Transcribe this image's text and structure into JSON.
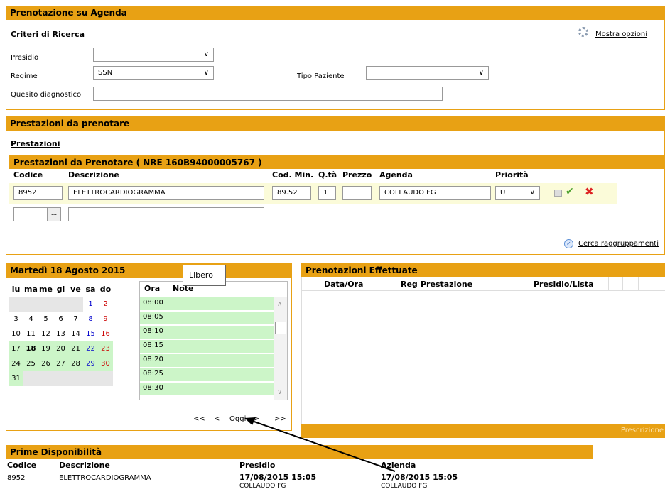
{
  "booking": {
    "title": "Prenotazione su Agenda",
    "criteria_title": "Criteri di Ricerca",
    "show_options": "Mostra opzioni",
    "presidio_label": "Presidio",
    "presidio_value": "",
    "regime_label": "Regime",
    "regime_value": "SSN",
    "tipo_paziente_label": "Tipo Paziente",
    "tipo_paziente_value": "",
    "quesito_label": "Quesito diagnostico",
    "quesito_value": ""
  },
  "prestazioni": {
    "title": "Prestazioni da prenotare",
    "link": "Prestazioni",
    "subtitle": "Prestazioni da Prenotare ( NRE 160B94000005767 )",
    "headers": [
      "Codice",
      "Descrizione",
      "Cod. Min.",
      "Q.tà",
      "Prezzo",
      "Agenda",
      "Priorità"
    ],
    "row": {
      "codice": "8952",
      "descrizione": "ELETTROCARDIOGRAMMA",
      "cod_min": "89.52",
      "qta": "1",
      "prezzo": "",
      "agenda": "COLLAUDO FG",
      "priorita": "U"
    },
    "ellipsis": "...",
    "cerca": "Cerca raggruppamenti"
  },
  "calendar": {
    "title": "Martedì 18 Agosto 2015",
    "days": [
      "lu",
      "ma",
      "me",
      "gi",
      "ve",
      "sa",
      "do"
    ],
    "weeks": [
      [
        "",
        "",
        "",
        "",
        "",
        "1",
        "2"
      ],
      [
        "3",
        "4",
        "5",
        "6",
        "7",
        "8",
        "9"
      ],
      [
        "10",
        "11",
        "12",
        "13",
        "14",
        "15",
        "16"
      ],
      [
        "17",
        "18",
        "19",
        "20",
        "21",
        "22",
        "23"
      ],
      [
        "24",
        "25",
        "26",
        "27",
        "28",
        "29",
        "30"
      ],
      [
        "31",
        "",
        "",
        "",
        "",
        "",
        ""
      ]
    ],
    "nav_first": "<<",
    "nav_prev": "<",
    "nav_today": "Oggi",
    "nav_next": ">",
    "nav_last": ">>"
  },
  "slots": {
    "col_ora": "Ora",
    "col_note": "Note",
    "tooltip": "Libero",
    "times": [
      "08:00",
      "08:05",
      "08:10",
      "08:15",
      "08:20",
      "08:25",
      "08:30"
    ]
  },
  "effettuate": {
    "title": "Prenotazioni Effettuate",
    "headers": [
      "Data/Ora",
      "Reg",
      "Prestazione",
      "Presidio/Lista"
    ],
    "footer": "Prescrizione"
  },
  "prime": {
    "title": "Prime Disponibilità",
    "headers": [
      "Codice",
      "Descrizione",
      "Presidio",
      "Azienda"
    ],
    "row": {
      "codice": "8952",
      "descrizione": "ELETTROCARDIOGRAMMA",
      "presidio_date": "17/08/2015 15:05",
      "presidio_name": "COLLAUDO FG",
      "azienda_date": "17/08/2015 15:05",
      "azienda_name": "COLLAUDO FG"
    }
  },
  "colors": {
    "accent": "#e8a114",
    "available": "#ccf5c8"
  }
}
